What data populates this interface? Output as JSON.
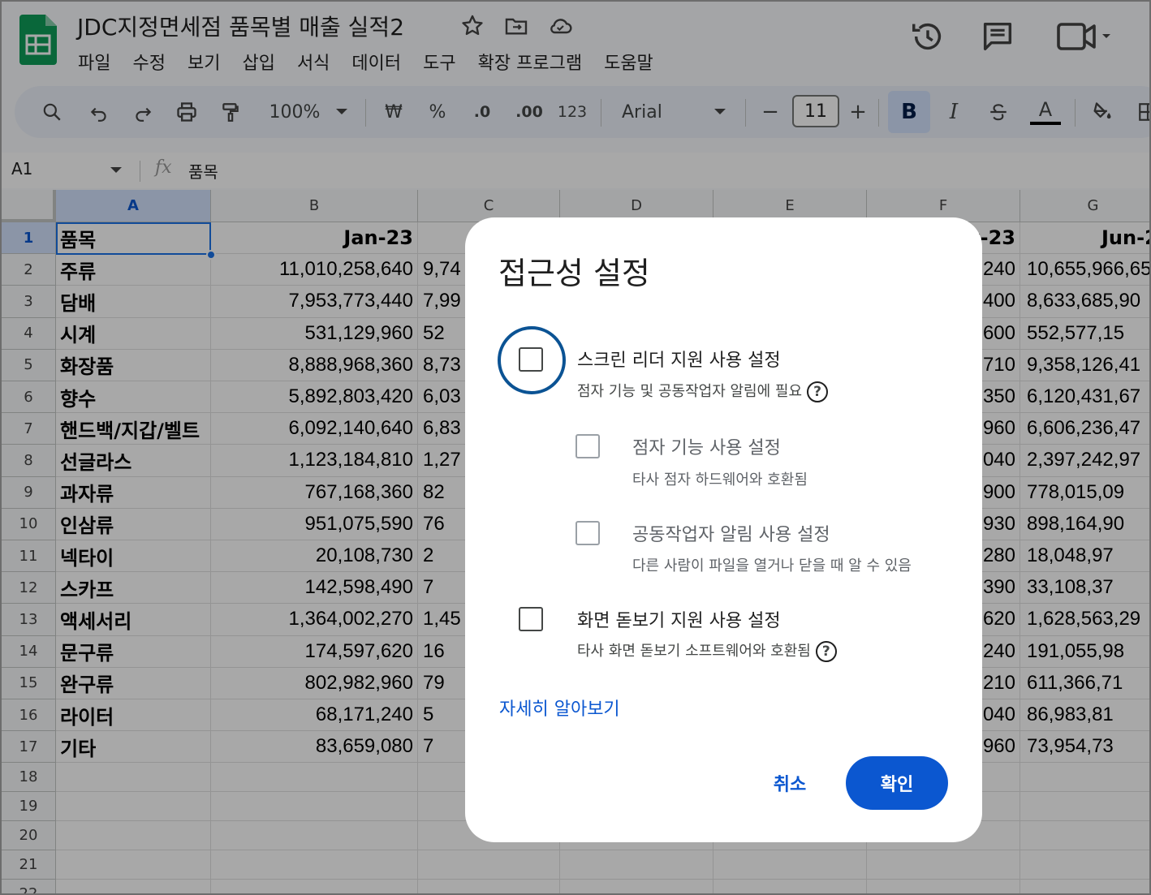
{
  "app": {
    "title": "JDC지정면세점 품목별 매출 실적2",
    "menu": [
      "파일",
      "수정",
      "보기",
      "삽입",
      "서식",
      "데이터",
      "도구",
      "확장 프로그램",
      "도움말"
    ]
  },
  "toolbar": {
    "zoom": "100%",
    "currency": "₩",
    "percent": "%",
    "decrease_decimals": ".0",
    "increase_decimals": ".00",
    "number_format": "123",
    "font": "Arial",
    "minus": "−",
    "font_size": "11",
    "plus": "+",
    "bold": "B",
    "italic": "I",
    "text_color": "A"
  },
  "formula_bar": {
    "cell_ref": "A1",
    "fx": "fx",
    "content": "품목"
  },
  "sheet": {
    "columns": [
      "A",
      "B",
      "C",
      "D",
      "E",
      "F",
      "G"
    ],
    "row_numbers": [
      "1",
      "2",
      "3",
      "4",
      "5",
      "6",
      "7",
      "8",
      "9",
      "10",
      "11",
      "12",
      "13",
      "14",
      "15",
      "16",
      "17",
      "18",
      "19",
      "20",
      "21",
      "22"
    ],
    "header_row": {
      "a": "품목",
      "b": "Jan-23",
      "f_partial": "y-23",
      "g_partial": "Jun-2"
    },
    "rows": [
      {
        "a": "주류",
        "b": "11,010,258,640",
        "c": "9,74",
        "f": "240",
        "g": "10,655,966,65"
      },
      {
        "a": "담배",
        "b": "7,953,773,440",
        "c": "7,99",
        "f": "400",
        "g": "8,633,685,90"
      },
      {
        "a": "시계",
        "b": "531,129,960",
        "c": "52",
        "f": "600",
        "g": "552,577,15"
      },
      {
        "a": "화장품",
        "b": "8,888,968,360",
        "c": "8,73",
        "f": "710",
        "g": "9,358,126,41"
      },
      {
        "a": "향수",
        "b": "5,892,803,420",
        "c": "6,03",
        "f": "350",
        "g": "6,120,431,67"
      },
      {
        "a": "핸드백/지갑/벨트",
        "b": "6,092,140,640",
        "c": "6,83",
        "f": "960",
        "g": "6,606,236,47"
      },
      {
        "a": "선글라스",
        "b": "1,123,184,810",
        "c": "1,27",
        "f": "040",
        "g": "2,397,242,97"
      },
      {
        "a": "과자류",
        "b": "767,168,360",
        "c": "82",
        "f": "900",
        "g": "778,015,09"
      },
      {
        "a": "인삼류",
        "b": "951,075,590",
        "c": "76",
        "f": "930",
        "g": "898,164,90"
      },
      {
        "a": "넥타이",
        "b": "20,108,730",
        "c": "2",
        "f": "280",
        "g": "18,048,97"
      },
      {
        "a": "스카프",
        "b": "142,598,490",
        "c": "7",
        "f": "390",
        "g": "33,108,37"
      },
      {
        "a": "액세서리",
        "b": "1,364,002,270",
        "c": "1,45",
        "f": "620",
        "g": "1,628,563,29"
      },
      {
        "a": "문구류",
        "b": "174,597,620",
        "c": "16",
        "f": "240",
        "g": "191,055,98"
      },
      {
        "a": "완구류",
        "b": "802,982,960",
        "c": "79",
        "f": "210",
        "g": "611,366,71"
      },
      {
        "a": "라이터",
        "b": "68,171,240",
        "c": "5",
        "f": "040",
        "g": "86,983,81"
      },
      {
        "a": "기타",
        "b": "83,659,080",
        "c": "7",
        "f": "960",
        "g": "73,954,73"
      }
    ]
  },
  "dialog": {
    "title": "접근성 설정",
    "screen_reader": {
      "label": "스크린 리더 지원 사용 설정",
      "desc": "점자 기능 및 공동작업자 알림에 필요",
      "checked": false
    },
    "braille": {
      "label": "점자 기능 사용 설정",
      "desc": "타사 점자 하드웨어와 호환됨",
      "checked": false
    },
    "collab": {
      "label": "공동작업자 알림 사용 설정",
      "desc": "다른 사람이 파일을 열거나 닫을 때 알 수 있음",
      "checked": false
    },
    "magnifier": {
      "label": "화면 돋보기 지원 사용 설정",
      "desc": "타사 화면 돋보기 소프트웨어와 호환됨",
      "checked": false
    },
    "help": "?",
    "learn_more": "자세히 알아보기",
    "cancel": "취소",
    "ok": "확인"
  },
  "colors": {
    "accent": "#0b57d0",
    "focus_ring": "#0b5394",
    "sheets_green": "#0f9d58"
  }
}
